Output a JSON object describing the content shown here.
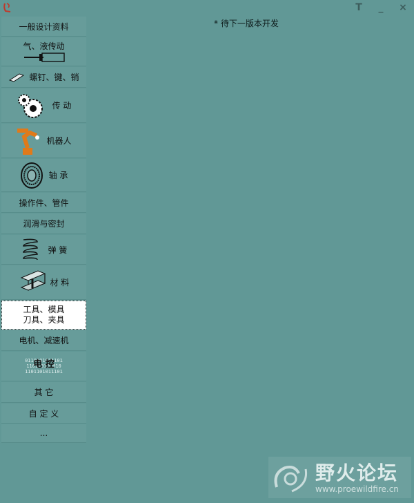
{
  "window": {
    "title_controls": {
      "t": "T",
      "min": "_",
      "close": "×"
    }
  },
  "notice": "* 待下一版本开发",
  "sidebar": {
    "items": [
      {
        "label": "一般设计资料"
      },
      {
        "label": "气、液传动"
      },
      {
        "label": "螺钉、键、销"
      },
      {
        "label": "传 动"
      },
      {
        "label": "机器人"
      },
      {
        "label": "轴 承"
      },
      {
        "label": "操作件、管件"
      },
      {
        "label": "润滑与密封"
      },
      {
        "label": "弹 簧"
      },
      {
        "label": "材 料"
      },
      {
        "label_line1": "工具、模具",
        "label_line2": "刀具、夹具"
      },
      {
        "label": "电机、减速机"
      },
      {
        "label": "电 控",
        "bits": [
          "0110101011101",
          "110110101010",
          "1101101011101"
        ]
      },
      {
        "label": "其 它"
      },
      {
        "label": "自 定 义"
      },
      {
        "label": "..."
      }
    ]
  },
  "watermark": {
    "cn": "野火论坛",
    "url": "www.proewildfire.cn"
  },
  "colors": {
    "background": "#619896",
    "sidebar_item": "#679c9a",
    "selected": "#ffffff"
  }
}
